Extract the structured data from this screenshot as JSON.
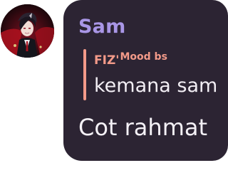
{
  "chat": {
    "sender_name": "Sam",
    "reply": {
      "author": "FIZ'",
      "author_tag": "Mood bs",
      "text": "kemana sam"
    },
    "message_text": "Cot rahmat"
  },
  "colors": {
    "bubble_bg": "#2c2433",
    "sender_name": "#a996e6",
    "reply_accent": "#f39a89",
    "message_text": "#f4f1f6"
  },
  "icons": {
    "avatar": "user-avatar-anime-character"
  }
}
